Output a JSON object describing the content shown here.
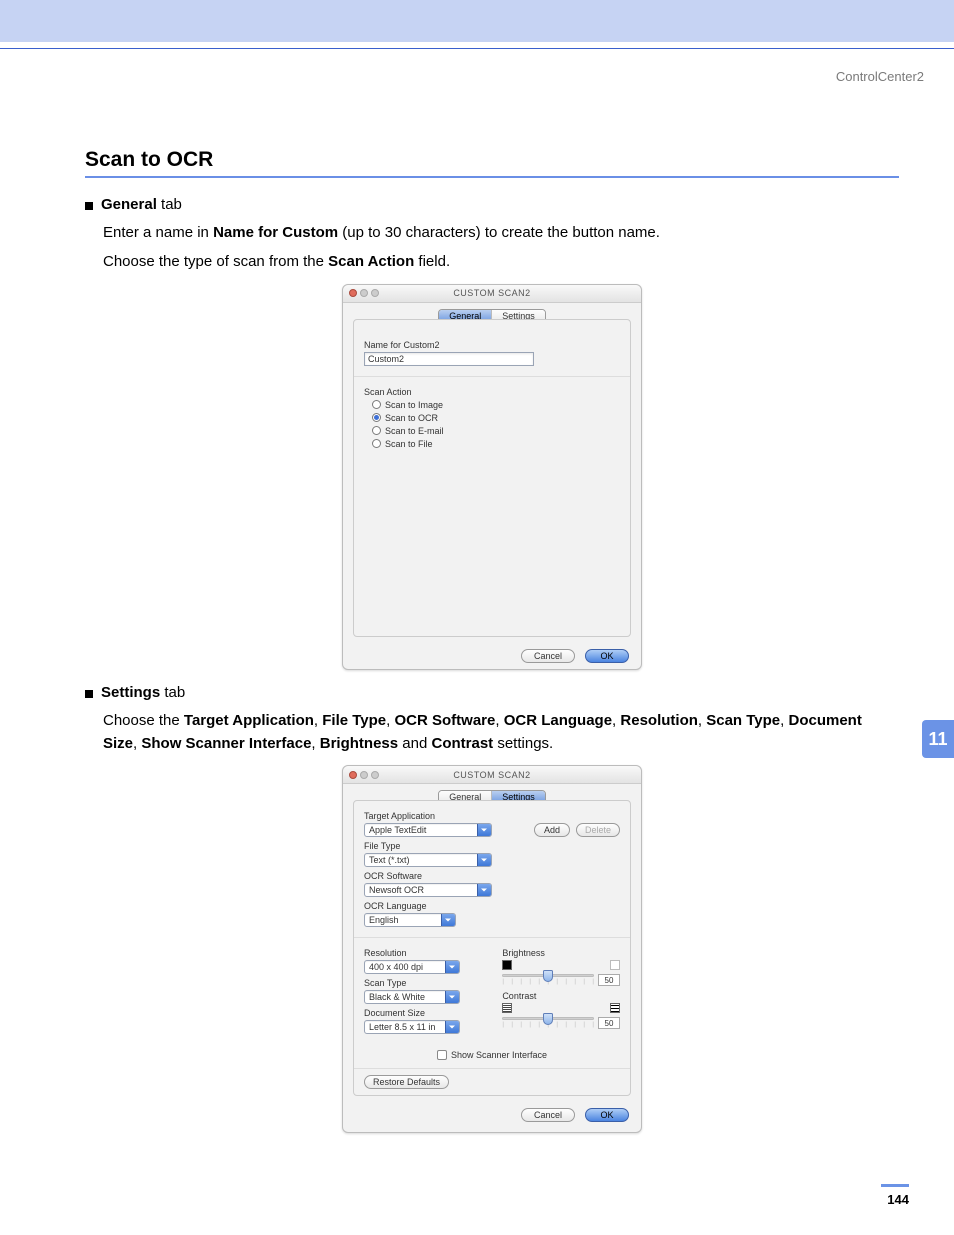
{
  "header": {
    "breadcrumb": "ControlCenter2"
  },
  "page_number": "144",
  "chapter_number": "11",
  "section_title": "Scan to OCR",
  "general": {
    "tab_label_prefix": "General",
    "tab_label_suffix": " tab",
    "line1_a": "Enter a name in ",
    "line1_b": "Name for Custom",
    "line1_c": " (up to 30 characters) to create the button name.",
    "line2_a": "Choose the type of scan from the ",
    "line2_b": "Scan Action",
    "line2_c": " field."
  },
  "settings_intro": {
    "tab_label_prefix": "Settings",
    "tab_label_suffix": " tab",
    "line_a": "Choose the ",
    "b1": "Target Application",
    "c1": ", ",
    "b2": "File Type",
    "c2": ", ",
    "b3": "OCR Software",
    "c3": ", ",
    "b4": "OCR Language",
    "c4": ", ",
    "b5": "Resolution",
    "c5": ", ",
    "b6": "Scan Type",
    "c6": ", ",
    "b7": "Document Size",
    "c7": ", ",
    "b8": "Show Scanner Interface",
    "c8": ", ",
    "b9": "Brightness",
    "c9": " and ",
    "b10": "Contrast",
    "c10": " settings."
  },
  "dialog1": {
    "title": "CUSTOM SCAN2",
    "tabs": {
      "general": "General",
      "settings": "Settings"
    },
    "name_label": "Name for Custom2",
    "name_value": "Custom2",
    "scan_action_label": "Scan Action",
    "radios": {
      "image": "Scan to Image",
      "ocr": "Scan to OCR",
      "email": "Scan to E-mail",
      "file": "Scan to File"
    },
    "buttons": {
      "cancel": "Cancel",
      "ok": "OK"
    }
  },
  "dialog2": {
    "title": "CUSTOM SCAN2",
    "tabs": {
      "general": "General",
      "settings": "Settings"
    },
    "target_app_label": "Target Application",
    "target_app_value": "Apple TextEdit",
    "add_label": "Add",
    "delete_label": "Delete",
    "file_type_label": "File Type",
    "file_type_value": "Text (*.txt)",
    "ocr_sw_label": "OCR Software",
    "ocr_sw_value": "Newsoft OCR",
    "ocr_lang_label": "OCR Language",
    "ocr_lang_value": "English",
    "resolution_label": "Resolution",
    "resolution_value": "400 x 400 dpi",
    "scan_type_label": "Scan Type",
    "scan_type_value": "Black & White",
    "doc_size_label": "Document Size",
    "doc_size_value": "Letter  8.5 x 11 in",
    "brightness_label": "Brightness",
    "brightness_value": "50",
    "contrast_label": "Contrast",
    "contrast_value": "50",
    "show_scanner_label": "Show Scanner Interface",
    "restore_label": "Restore Defaults",
    "buttons": {
      "cancel": "Cancel",
      "ok": "OK"
    }
  }
}
